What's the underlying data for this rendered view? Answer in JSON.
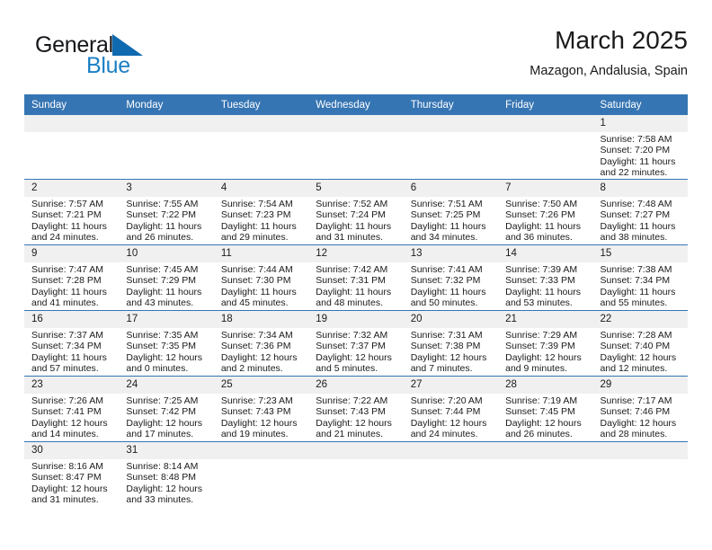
{
  "brand": {
    "name_primary": "General",
    "name_secondary": "Blue",
    "flag_icon": "triangle-flag-icon",
    "accent_color": "#1b7fc4"
  },
  "header": {
    "title": "March 2025",
    "subtitle": "Mazagon, Andalusia, Spain"
  },
  "theme": {
    "header_bar_color": "#3675b3",
    "daynum_bg_color": "#f0f0f0",
    "row_divider_color": "#3675b3"
  },
  "weekdays": [
    "Sunday",
    "Monday",
    "Tuesday",
    "Wednesday",
    "Thursday",
    "Friday",
    "Saturday"
  ],
  "weeks": [
    [
      {
        "day": "",
        "blank": true,
        "lines": []
      },
      {
        "day": "",
        "blank": true,
        "lines": []
      },
      {
        "day": "",
        "blank": true,
        "lines": []
      },
      {
        "day": "",
        "blank": true,
        "lines": []
      },
      {
        "day": "",
        "blank": true,
        "lines": []
      },
      {
        "day": "",
        "blank": true,
        "lines": []
      },
      {
        "day": "1",
        "blank": false,
        "lines": [
          "Sunrise: 7:58 AM",
          "Sunset: 7:20 PM",
          "Daylight: 11 hours",
          "and 22 minutes."
        ]
      }
    ],
    [
      {
        "day": "2",
        "blank": false,
        "lines": [
          "Sunrise: 7:57 AM",
          "Sunset: 7:21 PM",
          "Daylight: 11 hours",
          "and 24 minutes."
        ]
      },
      {
        "day": "3",
        "blank": false,
        "lines": [
          "Sunrise: 7:55 AM",
          "Sunset: 7:22 PM",
          "Daylight: 11 hours",
          "and 26 minutes."
        ]
      },
      {
        "day": "4",
        "blank": false,
        "lines": [
          "Sunrise: 7:54 AM",
          "Sunset: 7:23 PM",
          "Daylight: 11 hours",
          "and 29 minutes."
        ]
      },
      {
        "day": "5",
        "blank": false,
        "lines": [
          "Sunrise: 7:52 AM",
          "Sunset: 7:24 PM",
          "Daylight: 11 hours",
          "and 31 minutes."
        ]
      },
      {
        "day": "6",
        "blank": false,
        "lines": [
          "Sunrise: 7:51 AM",
          "Sunset: 7:25 PM",
          "Daylight: 11 hours",
          "and 34 minutes."
        ]
      },
      {
        "day": "7",
        "blank": false,
        "lines": [
          "Sunrise: 7:50 AM",
          "Sunset: 7:26 PM",
          "Daylight: 11 hours",
          "and 36 minutes."
        ]
      },
      {
        "day": "8",
        "blank": false,
        "lines": [
          "Sunrise: 7:48 AM",
          "Sunset: 7:27 PM",
          "Daylight: 11 hours",
          "and 38 minutes."
        ]
      }
    ],
    [
      {
        "day": "9",
        "blank": false,
        "lines": [
          "Sunrise: 7:47 AM",
          "Sunset: 7:28 PM",
          "Daylight: 11 hours",
          "and 41 minutes."
        ]
      },
      {
        "day": "10",
        "blank": false,
        "lines": [
          "Sunrise: 7:45 AM",
          "Sunset: 7:29 PM",
          "Daylight: 11 hours",
          "and 43 minutes."
        ]
      },
      {
        "day": "11",
        "blank": false,
        "lines": [
          "Sunrise: 7:44 AM",
          "Sunset: 7:30 PM",
          "Daylight: 11 hours",
          "and 45 minutes."
        ]
      },
      {
        "day": "12",
        "blank": false,
        "lines": [
          "Sunrise: 7:42 AM",
          "Sunset: 7:31 PM",
          "Daylight: 11 hours",
          "and 48 minutes."
        ]
      },
      {
        "day": "13",
        "blank": false,
        "lines": [
          "Sunrise: 7:41 AM",
          "Sunset: 7:32 PM",
          "Daylight: 11 hours",
          "and 50 minutes."
        ]
      },
      {
        "day": "14",
        "blank": false,
        "lines": [
          "Sunrise: 7:39 AM",
          "Sunset: 7:33 PM",
          "Daylight: 11 hours",
          "and 53 minutes."
        ]
      },
      {
        "day": "15",
        "blank": false,
        "lines": [
          "Sunrise: 7:38 AM",
          "Sunset: 7:34 PM",
          "Daylight: 11 hours",
          "and 55 minutes."
        ]
      }
    ],
    [
      {
        "day": "16",
        "blank": false,
        "lines": [
          "Sunrise: 7:37 AM",
          "Sunset: 7:34 PM",
          "Daylight: 11 hours",
          "and 57 minutes."
        ]
      },
      {
        "day": "17",
        "blank": false,
        "lines": [
          "Sunrise: 7:35 AM",
          "Sunset: 7:35 PM",
          "Daylight: 12 hours",
          "and 0 minutes."
        ]
      },
      {
        "day": "18",
        "blank": false,
        "lines": [
          "Sunrise: 7:34 AM",
          "Sunset: 7:36 PM",
          "Daylight: 12 hours",
          "and 2 minutes."
        ]
      },
      {
        "day": "19",
        "blank": false,
        "lines": [
          "Sunrise: 7:32 AM",
          "Sunset: 7:37 PM",
          "Daylight: 12 hours",
          "and 5 minutes."
        ]
      },
      {
        "day": "20",
        "blank": false,
        "lines": [
          "Sunrise: 7:31 AM",
          "Sunset: 7:38 PM",
          "Daylight: 12 hours",
          "and 7 minutes."
        ]
      },
      {
        "day": "21",
        "blank": false,
        "lines": [
          "Sunrise: 7:29 AM",
          "Sunset: 7:39 PM",
          "Daylight: 12 hours",
          "and 9 minutes."
        ]
      },
      {
        "day": "22",
        "blank": false,
        "lines": [
          "Sunrise: 7:28 AM",
          "Sunset: 7:40 PM",
          "Daylight: 12 hours",
          "and 12 minutes."
        ]
      }
    ],
    [
      {
        "day": "23",
        "blank": false,
        "lines": [
          "Sunrise: 7:26 AM",
          "Sunset: 7:41 PM",
          "Daylight: 12 hours",
          "and 14 minutes."
        ]
      },
      {
        "day": "24",
        "blank": false,
        "lines": [
          "Sunrise: 7:25 AM",
          "Sunset: 7:42 PM",
          "Daylight: 12 hours",
          "and 17 minutes."
        ]
      },
      {
        "day": "25",
        "blank": false,
        "lines": [
          "Sunrise: 7:23 AM",
          "Sunset: 7:43 PM",
          "Daylight: 12 hours",
          "and 19 minutes."
        ]
      },
      {
        "day": "26",
        "blank": false,
        "lines": [
          "Sunrise: 7:22 AM",
          "Sunset: 7:43 PM",
          "Daylight: 12 hours",
          "and 21 minutes."
        ]
      },
      {
        "day": "27",
        "blank": false,
        "lines": [
          "Sunrise: 7:20 AM",
          "Sunset: 7:44 PM",
          "Daylight: 12 hours",
          "and 24 minutes."
        ]
      },
      {
        "day": "28",
        "blank": false,
        "lines": [
          "Sunrise: 7:19 AM",
          "Sunset: 7:45 PM",
          "Daylight: 12 hours",
          "and 26 minutes."
        ]
      },
      {
        "day": "29",
        "blank": false,
        "lines": [
          "Sunrise: 7:17 AM",
          "Sunset: 7:46 PM",
          "Daylight: 12 hours",
          "and 28 minutes."
        ]
      }
    ],
    [
      {
        "day": "30",
        "blank": false,
        "lines": [
          "Sunrise: 8:16 AM",
          "Sunset: 8:47 PM",
          "Daylight: 12 hours",
          "and 31 minutes."
        ]
      },
      {
        "day": "31",
        "blank": false,
        "lines": [
          "Sunrise: 8:14 AM",
          "Sunset: 8:48 PM",
          "Daylight: 12 hours",
          "and 33 minutes."
        ]
      },
      {
        "day": "",
        "blank": true,
        "lines": []
      },
      {
        "day": "",
        "blank": true,
        "lines": []
      },
      {
        "day": "",
        "blank": true,
        "lines": []
      },
      {
        "day": "",
        "blank": true,
        "lines": []
      },
      {
        "day": "",
        "blank": true,
        "lines": []
      }
    ]
  ]
}
